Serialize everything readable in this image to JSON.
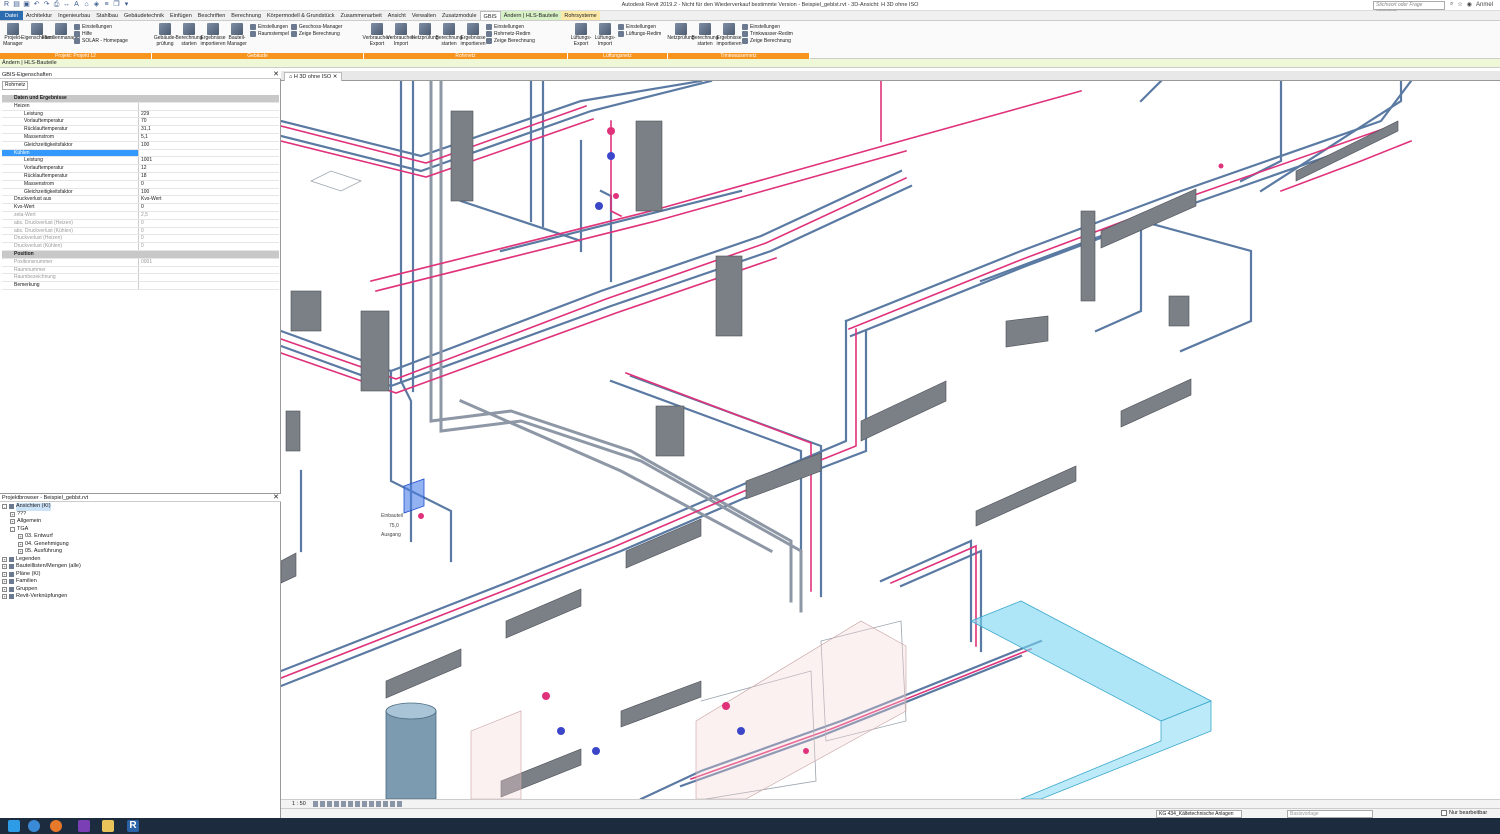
{
  "titlebar": {
    "title": "Autodesk Revit 2019.2 - Nicht für den Wiederverkauf bestimmte Version - Beispiel_geblst.rvt - 3D-Ansicht: H 3D ohne ISO",
    "search_placeholder": "Stichwort oder Frage eingeben",
    "user": "Anmel"
  },
  "tabs": [
    "Datei",
    "Architektur",
    "Ingenieurbau",
    "Stahlbau",
    "Gebäudetechnik",
    "Einfügen",
    "Beschriften",
    "Berechnung",
    "Körpermodell & Grundstück",
    "Zusammenarbeit",
    "Ansicht",
    "Verwalten",
    "Zusatzmodule",
    "GBIS",
    "Ändern | HLS-Bauteile",
    "Rohrsysteme"
  ],
  "ribbon": {
    "groups": [
      {
        "label": "Projekt: Projekt 12",
        "big": [
          "Projekt-Manager",
          "Eigenschaften",
          "Familienmanager"
        ],
        "small": [
          "Einstellungen",
          "Hilfe",
          "SOLAR - Homepage"
        ]
      },
      {
        "label": "Gebäude",
        "big": [
          "Gebäude-prüfung",
          "Berechnung starten",
          "Ergebnisse importieren",
          "Bauteil-Manager"
        ],
        "small": [
          "Einstellungen",
          "Raumstempel"
        ],
        "small2": [
          "Geschoss-Manager",
          "Zeige Berechnung"
        ]
      },
      {
        "label": "Rohrnetz",
        "big": [
          "Verbraucher-Export",
          "Verbraucher-Import",
          "Netzprüfung",
          "Berechnung starten",
          "Ergebnisse importieren"
        ],
        "small": [
          "Einstellungen",
          "Rohrnetz-Redim",
          "Zeige Berechnung"
        ]
      },
      {
        "label": "Lüftungsnetz",
        "big": [
          "Lüftungs-Export",
          "Lüftungs-Import"
        ],
        "small": [
          "Einstellungen",
          "Lüftungs-Redim"
        ]
      },
      {
        "label": "Trinkwassernetz",
        "big": [
          "Netzprüfung",
          "Berechnung starten",
          "Ergebnisse importieren"
        ],
        "small": [
          "Einstellungen",
          "Trinkwasser-Redim",
          "Zeige Berechnung"
        ]
      }
    ]
  },
  "context_label": "Ändern | HLS-Bauteile",
  "properties": {
    "title": "GBIS-Eigenschaften",
    "dropdown": "Rohrnetz",
    "rows": [
      {
        "k": "Daten und Ergebnisse",
        "v": "",
        "cls": "hdr"
      },
      {
        "k": "Heizen",
        "v": "",
        "cls": "sub"
      },
      {
        "k": "Leistung",
        "v": "229",
        "cls": "ind"
      },
      {
        "k": "Vorlauftemperatur",
        "v": "70",
        "cls": "ind"
      },
      {
        "k": "Rücklauftemperatur",
        "v": "31,1",
        "cls": "ind"
      },
      {
        "k": "Massenstrom",
        "v": "5,1",
        "cls": "ind"
      },
      {
        "k": "Gleichzeitigkeitsfaktor",
        "v": "100",
        "cls": "ind"
      },
      {
        "k": "Kühlen",
        "v": "",
        "cls": "sub sel"
      },
      {
        "k": "Leistung",
        "v": "1001",
        "cls": "ind"
      },
      {
        "k": "Vorlauftemperatur",
        "v": "12",
        "cls": "ind"
      },
      {
        "k": "Rücklauftemperatur",
        "v": "18",
        "cls": "ind"
      },
      {
        "k": "Massenstrom",
        "v": "0",
        "cls": "ind"
      },
      {
        "k": "Gleichzeitigkeitsfaktor",
        "v": "100",
        "cls": "ind"
      },
      {
        "k": "Druckverlust aus",
        "v": "Kvs-Wert",
        "cls": "sub"
      },
      {
        "k": "Kvs-Wert",
        "v": "0",
        "cls": "sub"
      },
      {
        "k": "zeta-Wert",
        "v": "2,5",
        "cls": "sub grey"
      },
      {
        "k": "abs. Druckverlust (Heizen)",
        "v": "0",
        "cls": "sub grey"
      },
      {
        "k": "abs. Druckverlust (Kühlen)",
        "v": "0",
        "cls": "sub grey"
      },
      {
        "k": "Druckverlust (Heizen)",
        "v": "0",
        "cls": "sub grey"
      },
      {
        "k": "Druckverlust (Kühlen)",
        "v": "0",
        "cls": "sub grey"
      },
      {
        "k": "Position",
        "v": "",
        "cls": "hdr"
      },
      {
        "k": "Positionsnummer",
        "v": "0001",
        "cls": "sub grey"
      },
      {
        "k": "Raumnummer",
        "v": "",
        "cls": "sub grey"
      },
      {
        "k": "Raumbezeichnung",
        "v": "",
        "cls": "sub grey"
      },
      {
        "k": "Bemerkung",
        "v": "",
        "cls": "sub"
      }
    ]
  },
  "browser": {
    "title": "Projektbrowser - Beispiel_geblst.rvt",
    "items": [
      {
        "label": "Ansichten (KI)",
        "level": 0,
        "toggle": "-",
        "sel": true
      },
      {
        "label": "???",
        "level": 1,
        "toggle": "+"
      },
      {
        "label": "Allgemein",
        "level": 1,
        "toggle": "+"
      },
      {
        "label": "TGA",
        "level": 1,
        "toggle": "-"
      },
      {
        "label": "03. Entwurf",
        "level": 2,
        "toggle": "+"
      },
      {
        "label": "04. Genehmigung",
        "level": 2,
        "toggle": "+"
      },
      {
        "label": "05. Ausführung",
        "level": 2,
        "toggle": "+"
      },
      {
        "label": "Legenden",
        "level": 0,
        "toggle": "+"
      },
      {
        "label": "Bauteillisten/Mengen (alle)",
        "level": 0,
        "toggle": "+"
      },
      {
        "label": "Pläne (KI)",
        "level": 0,
        "toggle": "+"
      },
      {
        "label": "Familien",
        "level": 0,
        "toggle": "+"
      },
      {
        "label": "Gruppen",
        "level": 0,
        "toggle": "+"
      },
      {
        "label": "Revit-Verknüpfungen",
        "level": 0,
        "toggle": "+"
      }
    ]
  },
  "view": {
    "tab_label": "H 3D ohne ISO",
    "scale": "1 : 50",
    "annotations": [
      "Einbauteil",
      "75,0",
      "Ausgang"
    ]
  },
  "status": {
    "system": "KG 434_Kältetechnische Anlagen",
    "workset": "Basisvorlage",
    "edit_only": "Nur bearbeitbar"
  }
}
